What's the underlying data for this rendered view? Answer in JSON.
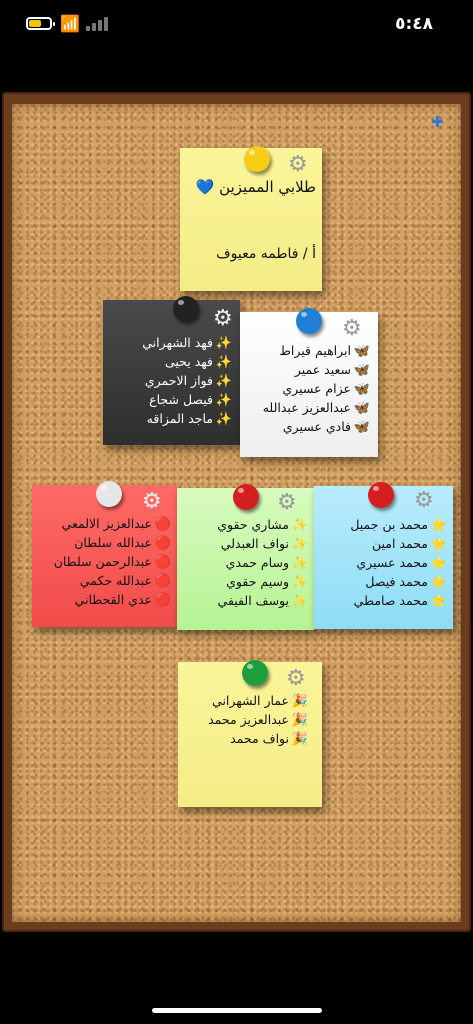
{
  "status_bar": {
    "time": "٥:٤٨",
    "battery_level": 0.5,
    "battery_color": "#f3c400"
  },
  "colors": {
    "frame": "#6b3d1e",
    "cork": "#d2a062",
    "plus": "#2a7be0"
  },
  "icons": {
    "corner": "plus-icon",
    "settings": "gear-icon",
    "pin": "pushpin-icon"
  },
  "title_note": {
    "title": "طلابي المميزين 💙",
    "teacher": "أ / فاطمه معيوف",
    "pin_color": "#f6cc15"
  },
  "notes": {
    "black": {
      "pin_color": "#222222",
      "emoji": "✨",
      "names": [
        "فهد الشهراني",
        "فهد يحيى",
        "فواز الاحمري",
        "فيصل شجاع",
        "ماجد المزاقه"
      ]
    },
    "white": {
      "pin_color": "#1f7fd6",
      "emoji": "🦋",
      "names": [
        "ابراهيم قيراط",
        "سعيد عمير",
        "عزام عسيري",
        "عبدالعزيز عبدالله",
        "فادي عسيري"
      ]
    },
    "red": {
      "pin_color": "#e6e6e6",
      "emoji": "🔴",
      "names": [
        "عبدالعزيز الالمعي",
        "عبدالله سلطان",
        "عبدالرحمن سلطان",
        "عبدالله حكمي",
        "عدي القحطاني"
      ]
    },
    "green": {
      "pin_color": "#d41f1f",
      "emoji": "✨",
      "names": [
        "مشاري حقوي",
        "نواف العبدلي",
        "وسام حمدي",
        "وسيم حقوي",
        "يوسف الفيفي"
      ]
    },
    "blue": {
      "pin_color": "#d41f1f",
      "emoji": "⭐",
      "names": [
        "محمد بن جميل",
        "محمد امين",
        "محمد عسيري",
        "محمد فيصل",
        "محمد صامطي"
      ]
    },
    "bottom": {
      "pin_color": "#1e9e3a",
      "emoji": "🎉",
      "names": [
        "عمار الشهراني",
        "عبدالعزيز محمد",
        "نواف محمد"
      ]
    }
  }
}
